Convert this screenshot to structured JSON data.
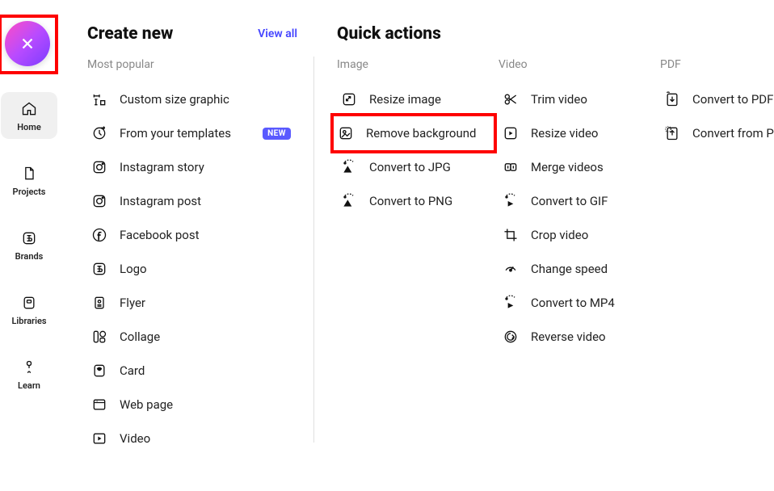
{
  "sidebar": {
    "items": [
      {
        "label": "Home",
        "icon": "home"
      },
      {
        "label": "Projects",
        "icon": "file"
      },
      {
        "label": "Brands",
        "icon": "brand"
      },
      {
        "label": "Libraries",
        "icon": "library"
      },
      {
        "label": "Learn",
        "icon": "learn"
      }
    ]
  },
  "create": {
    "title": "Create new",
    "view_all": "View all",
    "sub": "Most popular",
    "items": [
      {
        "label": "Custom size graphic",
        "icon": "custom-size"
      },
      {
        "label": "From your templates",
        "icon": "template",
        "badge": "NEW"
      },
      {
        "label": "Instagram story",
        "icon": "instagram"
      },
      {
        "label": "Instagram post",
        "icon": "instagram"
      },
      {
        "label": "Facebook post",
        "icon": "facebook"
      },
      {
        "label": "Logo",
        "icon": "logo"
      },
      {
        "label": "Flyer",
        "icon": "flyer"
      },
      {
        "label": "Collage",
        "icon": "collage"
      },
      {
        "label": "Card",
        "icon": "card"
      },
      {
        "label": "Web page",
        "icon": "webpage"
      },
      {
        "label": "Video",
        "icon": "video"
      }
    ]
  },
  "quick": {
    "title": "Quick actions",
    "cols": {
      "image": {
        "sub": "Image",
        "items": [
          {
            "label": "Resize image",
            "icon": "resize"
          },
          {
            "label": "Remove background",
            "icon": "removebg",
            "highlight": true
          },
          {
            "label": "Convert to JPG",
            "icon": "convertimg"
          },
          {
            "label": "Convert to PNG",
            "icon": "convertimg"
          }
        ]
      },
      "video": {
        "sub": "Video",
        "items": [
          {
            "label": "Trim video",
            "icon": "trim"
          },
          {
            "label": "Resize video",
            "icon": "resizevid"
          },
          {
            "label": "Merge videos",
            "icon": "merge"
          },
          {
            "label": "Convert to GIF",
            "icon": "convertvid"
          },
          {
            "label": "Crop video",
            "icon": "crop"
          },
          {
            "label": "Change speed",
            "icon": "speed"
          },
          {
            "label": "Convert to MP4",
            "icon": "convertvid"
          },
          {
            "label": "Reverse video",
            "icon": "reverse"
          }
        ]
      },
      "pdf": {
        "sub": "PDF",
        "items": [
          {
            "label": "Convert to PDF",
            "icon": "topdf"
          },
          {
            "label": "Convert from PDF",
            "icon": "frompdf"
          }
        ]
      }
    }
  }
}
